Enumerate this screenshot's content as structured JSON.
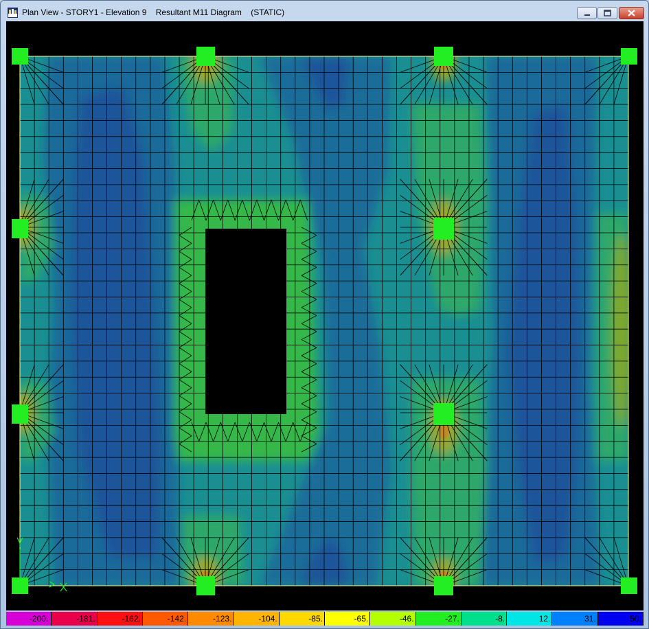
{
  "window": {
    "title": "Plan View - STORY1 - Elevation 9    Resultant M11 Diagram    (STATIC)",
    "app_icon": "etabs-app-icon",
    "controls": [
      "minimize-icon",
      "maximize-icon",
      "close-icon"
    ]
  },
  "view": {
    "background_color": "#000000",
    "slab_border_color": "#ffff99",
    "mesh_color": "#000000",
    "support_color": "#22ee22",
    "opening_color": "#000000",
    "axes": {
      "y_label": "Y",
      "x_label": "X",
      "color": "#22ee22"
    }
  },
  "legend": {
    "labels": [
      "-200.",
      "-181.",
      "-162.",
      "-142.",
      "-123.",
      "-104.",
      "-85.",
      "-65.",
      "-46.",
      "-27.",
      "-8.",
      "12.",
      "31.",
      "50."
    ],
    "colors": [
      "#d600d6",
      "#e8004a",
      "#ff1010",
      "#ff5a00",
      "#ff8a00",
      "#ffb400",
      "#ffd800",
      "#ffff00",
      "#b4ff00",
      "#22ee22",
      "#00e08c",
      "#00e6e6",
      "#0080ff",
      "#0000f0"
    ]
  }
}
